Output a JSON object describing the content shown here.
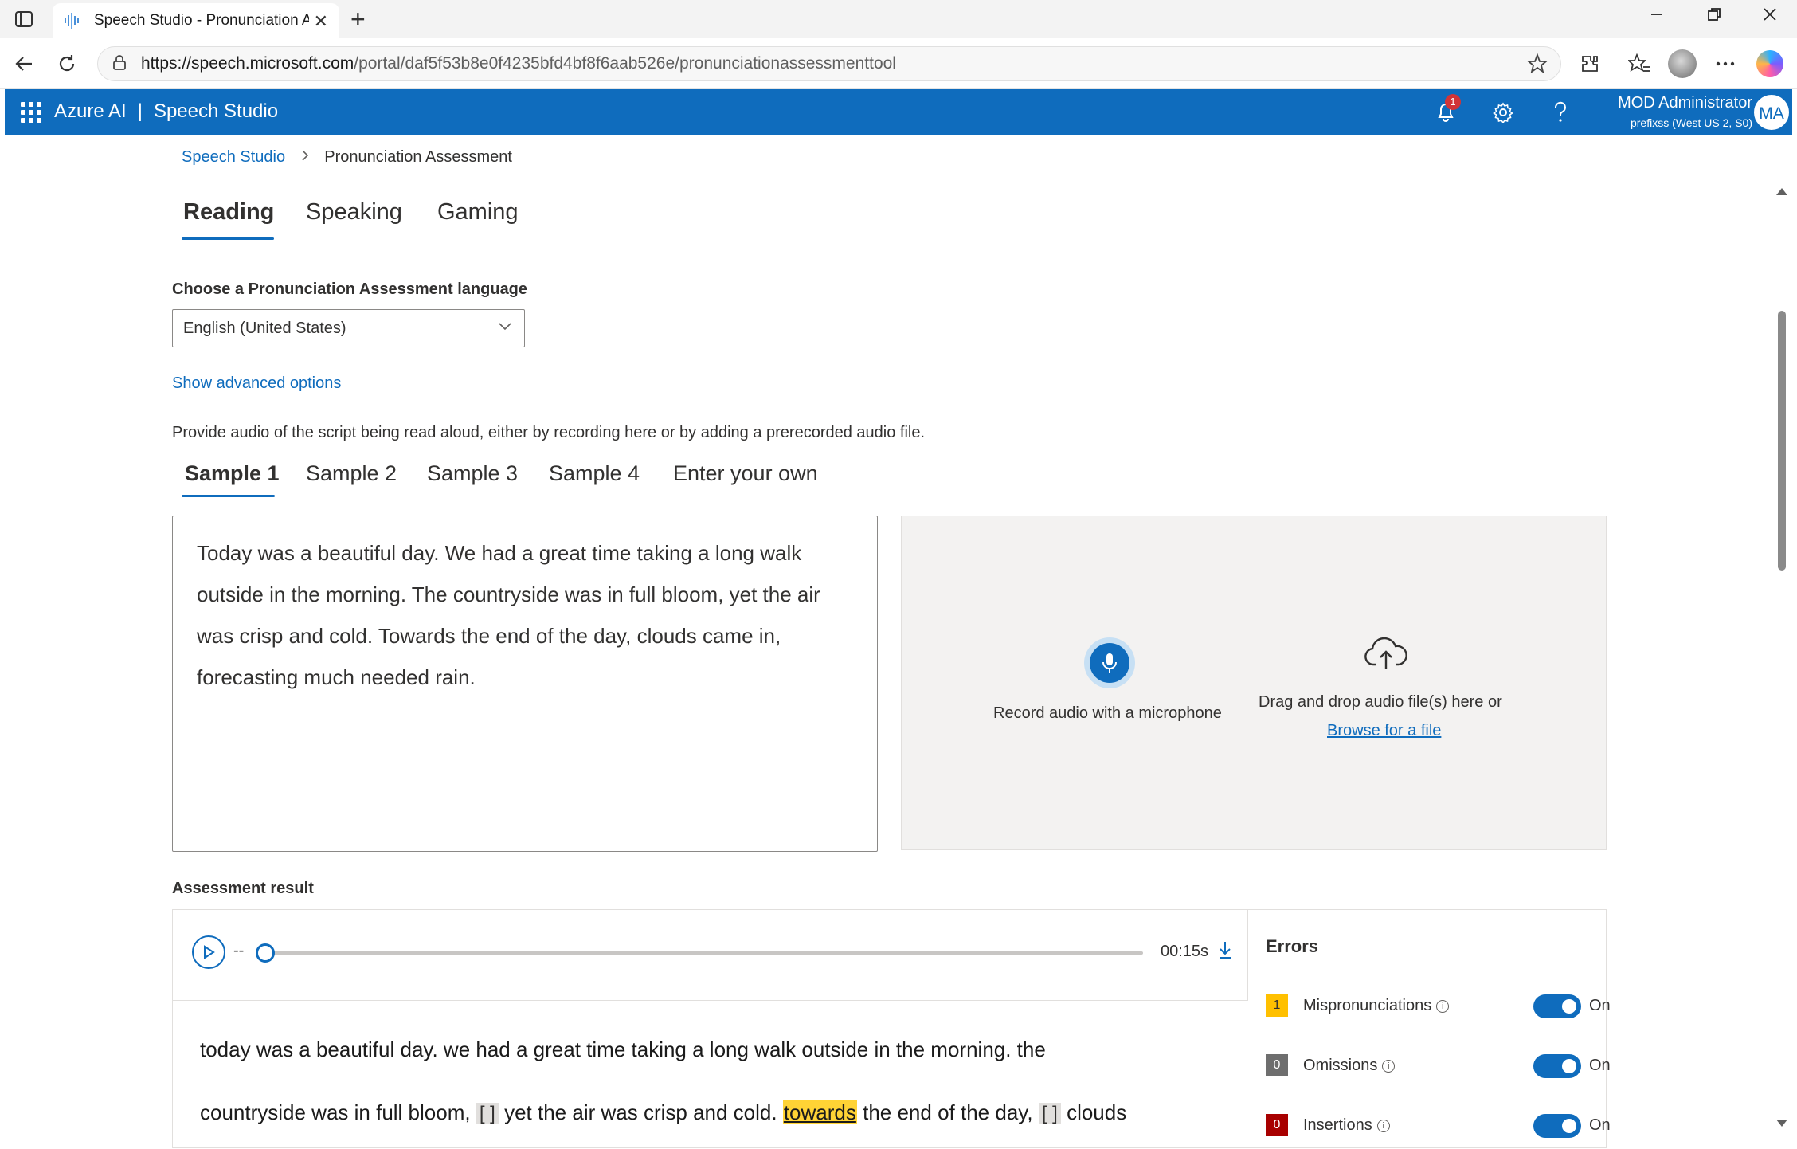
{
  "browser": {
    "tab_title": "Speech Studio - Pronunciation Assessment",
    "url_host": "https://speech.microsoft.com",
    "url_path": "/portal/daf5f53b8e0f4235bfd4bf8f6aab526e/pronunciationassessmenttool",
    "new_tab_glyph": "+",
    "close_glyph": "✕"
  },
  "header": {
    "brand_left": "Azure AI",
    "brand_sep": "|",
    "brand_right": "Speech Studio",
    "notification_count": "1",
    "user_name": "MOD Administrator",
    "user_sub": "prefixss (West US 2, S0)",
    "user_initials": "MA",
    "accent_color": "#0f6cbd"
  },
  "breadcrumb": {
    "root": "Speech Studio",
    "current": "Pronunciation Assessment"
  },
  "mode_tabs": [
    "Reading",
    "Speaking",
    "Gaming"
  ],
  "language": {
    "label": "Choose a Pronunciation Assessment language",
    "selected": "English (United States)"
  },
  "advanced_link": "Show advanced options",
  "provide_text": "Provide audio of the script being read aloud, either by recording here or by adding a prerecorded audio file.",
  "sample_tabs": [
    "Sample 1",
    "Sample 2",
    "Sample 3",
    "Sample 4",
    "Enter your own"
  ],
  "script_text": "Today was a beautiful day. We had a great time taking a long walk outside in the morning. The countryside was in full bloom, yet the air was crisp and cold. Towards the end of the day, clouds came in, forecasting much needed rain.",
  "audio": {
    "record_label": "Record audio with a microphone",
    "drag_label": "Drag and drop audio file(s) here or",
    "browse_label": "Browse for a file"
  },
  "result": {
    "label": "Assessment result",
    "position_text": "--",
    "duration": "00:15s",
    "progress": 0,
    "text_1": "today was a beautiful day. we had a great time taking a long walk outside in the morning. the",
    "text_2a": "countryside was in full bloom,",
    "gap_1": "[ ]",
    "text_2b": "yet the air was crisp and cold.",
    "mispronounced_word": "towards",
    "text_2c": "the end of the day,",
    "gap_2": "[ ]",
    "text_2d": "clouds"
  },
  "errors": {
    "title": "Errors",
    "items": [
      {
        "count": "1",
        "label": "Mispronunciations",
        "toggle": "On",
        "color": "#ffc000",
        "text_color": "#323130"
      },
      {
        "count": "0",
        "label": "Omissions",
        "toggle": "On",
        "color": "#6e6e6e",
        "text_color": "#ffffff"
      },
      {
        "count": "0",
        "label": "Insertions",
        "toggle": "On",
        "color": "#a80000",
        "text_color": "#ffffff"
      }
    ]
  }
}
